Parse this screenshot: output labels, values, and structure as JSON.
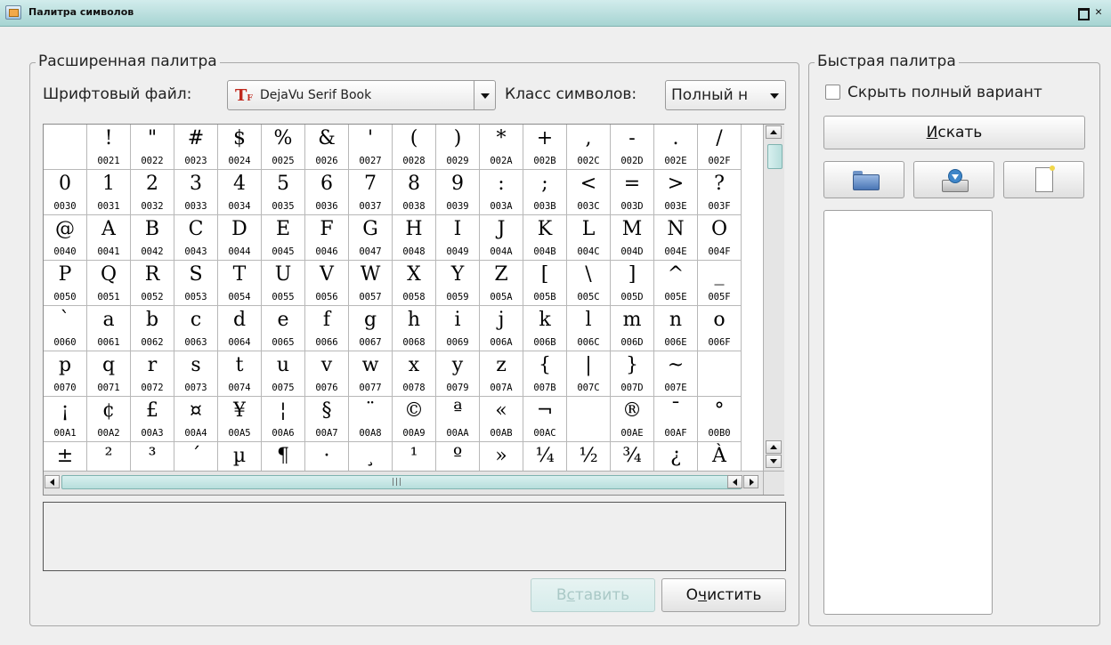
{
  "window": {
    "title": "Палитра символов"
  },
  "extended": {
    "legend": "Расширенная палитра",
    "font_file_label": "Шрифтовый файл:",
    "font_value": "DejaVu Serif Book",
    "font_icon": "TrueType-font-icon",
    "class_label": "Класс символов:",
    "class_value": "Полный н"
  },
  "grid": {
    "columns": 16,
    "rows": [
      [
        [
          "",
          ""
        ],
        [
          "!",
          "0021"
        ],
        [
          "\"",
          "0022"
        ],
        [
          "#",
          "0023"
        ],
        [
          "$",
          "0024"
        ],
        [
          "%",
          "0025"
        ],
        [
          "&",
          "0026"
        ],
        [
          "'",
          "0027"
        ],
        [
          "(",
          "0028"
        ],
        [
          ")",
          "0029"
        ],
        [
          "*",
          "002A"
        ],
        [
          "+",
          "002B"
        ],
        [
          ",",
          "002C"
        ],
        [
          "-",
          "002D"
        ],
        [
          ".",
          "002E"
        ],
        [
          "/",
          "002F"
        ]
      ],
      [
        [
          "0",
          "0030"
        ],
        [
          "1",
          "0031"
        ],
        [
          "2",
          "0032"
        ],
        [
          "3",
          "0033"
        ],
        [
          "4",
          "0034"
        ],
        [
          "5",
          "0035"
        ],
        [
          "6",
          "0036"
        ],
        [
          "7",
          "0037"
        ],
        [
          "8",
          "0038"
        ],
        [
          "9",
          "0039"
        ],
        [
          ":",
          "003A"
        ],
        [
          ";",
          "003B"
        ],
        [
          "<",
          "003C"
        ],
        [
          "=",
          "003D"
        ],
        [
          ">",
          "003E"
        ],
        [
          "?",
          "003F"
        ]
      ],
      [
        [
          "@",
          "0040"
        ],
        [
          "A",
          "0041"
        ],
        [
          "B",
          "0042"
        ],
        [
          "C",
          "0043"
        ],
        [
          "D",
          "0044"
        ],
        [
          "E",
          "0045"
        ],
        [
          "F",
          "0046"
        ],
        [
          "G",
          "0047"
        ],
        [
          "H",
          "0048"
        ],
        [
          "I",
          "0049"
        ],
        [
          "J",
          "004A"
        ],
        [
          "K",
          "004B"
        ],
        [
          "L",
          "004C"
        ],
        [
          "M",
          "004D"
        ],
        [
          "N",
          "004E"
        ],
        [
          "O",
          "004F"
        ]
      ],
      [
        [
          "P",
          "0050"
        ],
        [
          "Q",
          "0051"
        ],
        [
          "R",
          "0052"
        ],
        [
          "S",
          "0053"
        ],
        [
          "T",
          "0054"
        ],
        [
          "U",
          "0055"
        ],
        [
          "V",
          "0056"
        ],
        [
          "W",
          "0057"
        ],
        [
          "X",
          "0058"
        ],
        [
          "Y",
          "0059"
        ],
        [
          "Z",
          "005A"
        ],
        [
          "[",
          "005B"
        ],
        [
          "\\",
          "005C"
        ],
        [
          "]",
          "005D"
        ],
        [
          "^",
          "005E"
        ],
        [
          "_",
          "005F"
        ]
      ],
      [
        [
          "`",
          "0060"
        ],
        [
          "a",
          "0061"
        ],
        [
          "b",
          "0062"
        ],
        [
          "c",
          "0063"
        ],
        [
          "d",
          "0064"
        ],
        [
          "e",
          "0065"
        ],
        [
          "f",
          "0066"
        ],
        [
          "g",
          "0067"
        ],
        [
          "h",
          "0068"
        ],
        [
          "i",
          "0069"
        ],
        [
          "j",
          "006A"
        ],
        [
          "k",
          "006B"
        ],
        [
          "l",
          "006C"
        ],
        [
          "m",
          "006D"
        ],
        [
          "n",
          "006E"
        ],
        [
          "o",
          "006F"
        ]
      ],
      [
        [
          "p",
          "0070"
        ],
        [
          "q",
          "0071"
        ],
        [
          "r",
          "0072"
        ],
        [
          "s",
          "0073"
        ],
        [
          "t",
          "0074"
        ],
        [
          "u",
          "0075"
        ],
        [
          "v",
          "0076"
        ],
        [
          "w",
          "0077"
        ],
        [
          "x",
          "0078"
        ],
        [
          "y",
          "0079"
        ],
        [
          "z",
          "007A"
        ],
        [
          "{",
          "007B"
        ],
        [
          "|",
          "007C"
        ],
        [
          "}",
          "007D"
        ],
        [
          "~",
          "007E"
        ],
        [
          "",
          ""
        ]
      ],
      [
        [
          "¡",
          "00A1"
        ],
        [
          "¢",
          "00A2"
        ],
        [
          "£",
          "00A3"
        ],
        [
          "¤",
          "00A4"
        ],
        [
          "¥",
          "00A5"
        ],
        [
          "¦",
          "00A6"
        ],
        [
          "§",
          "00A7"
        ],
        [
          "¨",
          "00A8"
        ],
        [
          "©",
          "00A9"
        ],
        [
          "ª",
          "00AA"
        ],
        [
          "«",
          "00AB"
        ],
        [
          "¬",
          "00AC"
        ],
        [
          "",
          ""
        ],
        [
          "®",
          "00AE"
        ],
        [
          "¯",
          "00AF"
        ],
        [
          "°",
          "00B0"
        ]
      ],
      [
        [
          "±",
          ""
        ],
        [
          "²",
          ""
        ],
        [
          "³",
          ""
        ],
        [
          "´",
          ""
        ],
        [
          "µ",
          ""
        ],
        [
          "¶",
          ""
        ],
        [
          "·",
          ""
        ],
        [
          "¸",
          ""
        ],
        [
          "¹",
          ""
        ],
        [
          "º",
          ""
        ],
        [
          "»",
          ""
        ],
        [
          "¼",
          ""
        ],
        [
          "½",
          ""
        ],
        [
          "¾",
          ""
        ],
        [
          "¿",
          ""
        ],
        [
          "À",
          ""
        ]
      ]
    ]
  },
  "buttons": {
    "insert": {
      "pre": "В",
      "mnemonic": "с",
      "post": "тавить"
    },
    "clear": {
      "pre": "О",
      "mnemonic": "ч",
      "post": "истить"
    },
    "search": {
      "pre": "",
      "mnemonic": "И",
      "post": "скать"
    }
  },
  "quick": {
    "legend": "Быстрая палитра",
    "hide_full_label": "Скрыть полный вариант",
    "hide_full_checked": false
  },
  "icons": {
    "open": "folder-open-icon",
    "save": "save-icon",
    "new": "new-document-icon"
  },
  "colors": {
    "titlebar": "#a6d4d2",
    "disabled_text": "#a9c8c6"
  }
}
